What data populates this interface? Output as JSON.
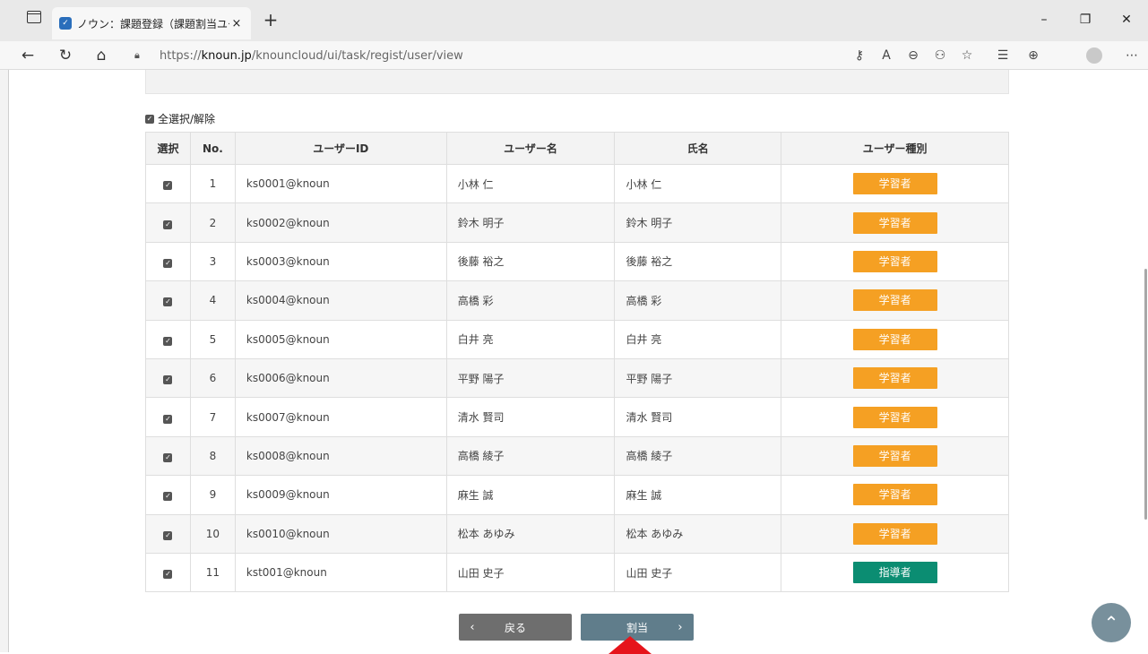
{
  "browser": {
    "tab_title": "ノウン：課題登録（課題割当ユーザ",
    "tab_close": "×",
    "new_tab": "+",
    "url_scheme": "https://",
    "url_host": "knoun.jp",
    "url_path": "/knouncloud/ui/task/regist/user/view"
  },
  "page": {
    "select_all_label": "全選択/解除",
    "columns": [
      "選択",
      "No.",
      "ユーザーID",
      "ユーザー名",
      "氏名",
      "ユーザー種別"
    ],
    "rows": [
      {
        "no": "1",
        "user_id": "ks0001@knoun",
        "user_name": "小林 仁",
        "full_name": "小林 仁",
        "type": "学習者",
        "checked": true
      },
      {
        "no": "2",
        "user_id": "ks0002@knoun",
        "user_name": "鈴木 明子",
        "full_name": "鈴木 明子",
        "type": "学習者",
        "checked": true
      },
      {
        "no": "3",
        "user_id": "ks0003@knoun",
        "user_name": "後藤 裕之",
        "full_name": "後藤 裕之",
        "type": "学習者",
        "checked": true
      },
      {
        "no": "4",
        "user_id": "ks0004@knoun",
        "user_name": "高橋 彩",
        "full_name": "高橋 彩",
        "type": "学習者",
        "checked": true
      },
      {
        "no": "5",
        "user_id": "ks0005@knoun",
        "user_name": "白井 亮",
        "full_name": "白井 亮",
        "type": "学習者",
        "checked": true
      },
      {
        "no": "6",
        "user_id": "ks0006@knoun",
        "user_name": "平野 陽子",
        "full_name": "平野 陽子",
        "type": "学習者",
        "checked": true
      },
      {
        "no": "7",
        "user_id": "ks0007@knoun",
        "user_name": "清水 賢司",
        "full_name": "清水 賢司",
        "type": "学習者",
        "checked": true
      },
      {
        "no": "8",
        "user_id": "ks0008@knoun",
        "user_name": "高橋 綾子",
        "full_name": "高橋 綾子",
        "type": "学習者",
        "checked": true
      },
      {
        "no": "9",
        "user_id": "ks0009@knoun",
        "user_name": "麻生 誠",
        "full_name": "麻生 誠",
        "type": "学習者",
        "checked": true
      },
      {
        "no": "10",
        "user_id": "ks0010@knoun",
        "user_name": "松本 あゆみ",
        "full_name": "松本 あゆみ",
        "type": "学習者",
        "checked": true
      },
      {
        "no": "11",
        "user_id": "kst001@knoun",
        "user_name": "山田 史子",
        "full_name": "山田 史子",
        "type": "指導者",
        "checked": true
      }
    ],
    "back_label": "戻る",
    "assign_label": "割当"
  },
  "colors": {
    "learner_badge": "#f5a023",
    "instructor_badge": "#0b8d72",
    "assign_button": "#607d8b",
    "back_button": "#6e6e6e",
    "annotation_arrow": "#e6141b"
  },
  "icons": {
    "back": "arrow-left-icon",
    "refresh": "refresh-icon",
    "home": "home-icon",
    "lock": "lock-icon",
    "back_btn_chevron": "chevron-left-icon",
    "assign_btn_chevron": "chevron-right-icon",
    "scroll_top": "chevron-up-icon"
  }
}
